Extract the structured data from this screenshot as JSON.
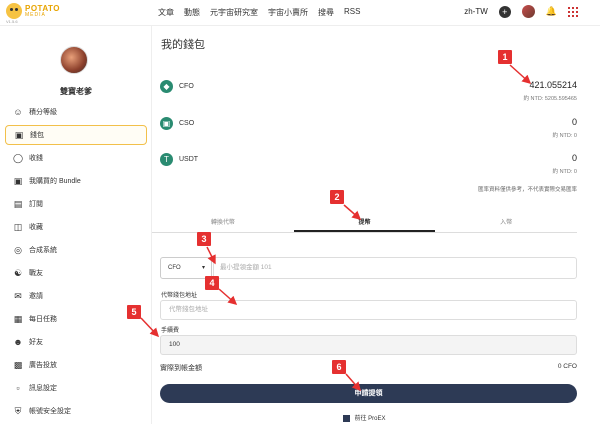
{
  "brand": {
    "line1": "POTATO",
    "line2": "MEDIA",
    "version": "V1.5.6"
  },
  "nav": [
    "文章",
    "動態",
    "元宇宙研究室",
    "宇宙小賣所",
    "搜尋",
    "RSS"
  ],
  "language": "zh-TW",
  "sidebar": {
    "user_name": "雙寶老爹",
    "items": [
      {
        "label": "積分等級",
        "icon": "person-icon"
      },
      {
        "label": "錢包",
        "icon": "wallet-icon",
        "active": true
      },
      {
        "label": "收錢",
        "icon": "coin-icon"
      },
      {
        "label": "我購買的 Bundle",
        "icon": "bundle-icon"
      },
      {
        "label": "訂閱",
        "icon": "subscribe-icon"
      },
      {
        "label": "收藏",
        "icon": "bookmark-icon"
      },
      {
        "label": "合成系統",
        "icon": "synthesis-icon"
      },
      {
        "label": "戰友",
        "icon": "comrade-icon"
      },
      {
        "label": "邀請",
        "icon": "invite-icon"
      },
      {
        "label": "每日任務",
        "icon": "calendar-icon"
      },
      {
        "label": "好友",
        "icon": "friends-icon"
      },
      {
        "label": "廣告投放",
        "icon": "ads-icon"
      },
      {
        "label": "訊息設定",
        "icon": "message-icon"
      },
      {
        "label": "帳號安全設定",
        "icon": "security-icon"
      }
    ]
  },
  "wallet": {
    "title": "我的錢包",
    "coins": [
      {
        "name": "CFO",
        "balance": "421.055214",
        "ntd": "約 NTD: 5205.595465"
      },
      {
        "name": "CSO",
        "balance": "0",
        "ntd": "約 NTD: 0"
      },
      {
        "name": "USDT",
        "balance": "0",
        "ntd": "約 NTD: 0"
      }
    ],
    "rate_note": "匯率資料僅供參考，不代表實際交易匯率"
  },
  "tabs": [
    "轉換代幣",
    "提幣",
    "入幣"
  ],
  "withdraw": {
    "coin_select": "CFO",
    "amount_placeholder": "最小提領金額 101",
    "address_label": "代幣錢包地址",
    "address_placeholder": "代幣錢包地址",
    "fee_label": "手續費",
    "fee_value": "100",
    "actual_label": "實際到帳金額",
    "actual_value": "0 CFO",
    "submit_label": "申請提領",
    "proex_label": "前往 ProEX"
  },
  "annotations": [
    "1",
    "2",
    "3",
    "4",
    "5",
    "6"
  ],
  "colors": {
    "accent": "#f2c04a",
    "marker": "#e53030",
    "button": "#2d3a55",
    "coin": "#2a8b71"
  }
}
